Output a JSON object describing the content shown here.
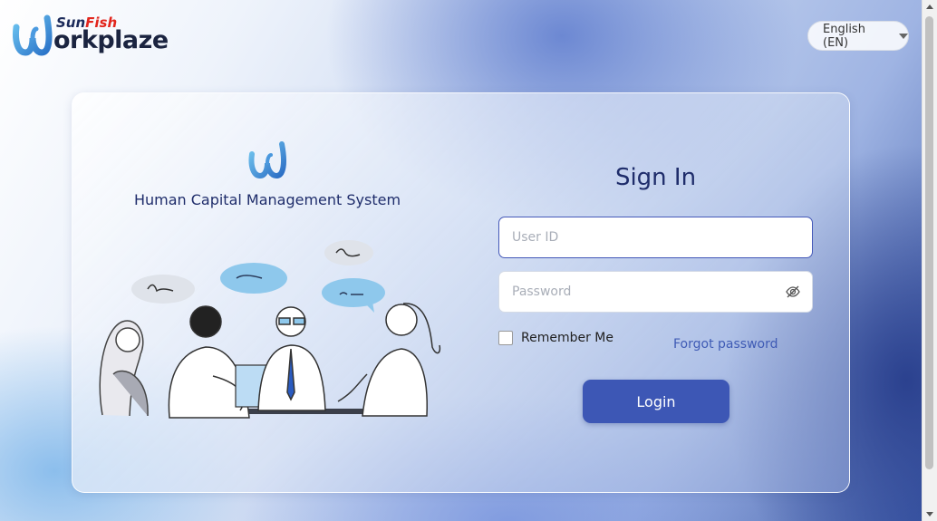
{
  "logo": {
    "brand_top_1": "Sun",
    "brand_top_2": "Fish",
    "brand_word": "orkplaze"
  },
  "language": {
    "label": "English (EN)"
  },
  "left_panel": {
    "title": "Human Capital Management System"
  },
  "form": {
    "heading": "Sign In",
    "user_id_placeholder": "User ID",
    "user_id_value": "",
    "password_placeholder": "Password",
    "password_value": "",
    "remember_label": "Remember Me",
    "remember_checked": false,
    "forgot_label": "Forgot password",
    "login_label": "Login"
  },
  "icons": {
    "logo": "workplaze-w-logo-icon",
    "lang_caret": "caret-down-icon",
    "password_toggle": "eye-slash-icon"
  },
  "colors": {
    "primary": "#3d57b5",
    "heading": "#1f2d6b",
    "link": "#3f5bb5",
    "logo_accent": "#e2261d"
  }
}
